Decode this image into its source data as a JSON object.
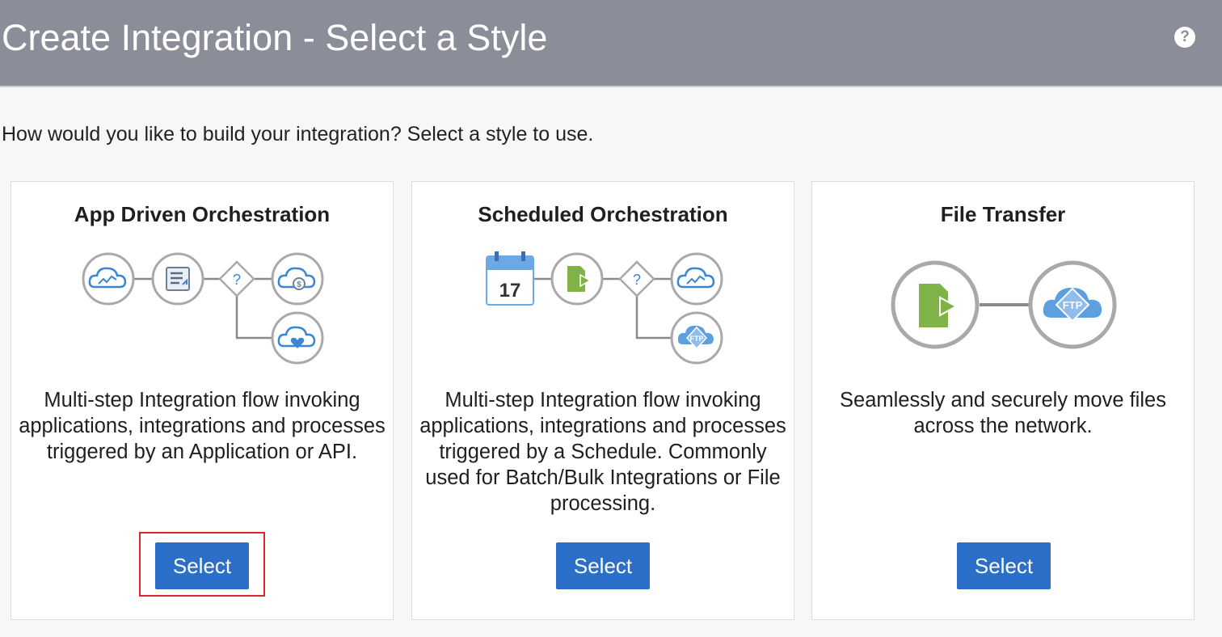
{
  "header": {
    "title": "Create Integration - Select a Style",
    "help_glyph": "?"
  },
  "intro_text": "How would you like to build your integration? Select a style to use.",
  "cards": [
    {
      "title": "App Driven Orchestration",
      "description": "Multi-step Integration flow invoking applications, integrations and processes triggered by an Application or API.",
      "button_label": "Select",
      "highlighted": true
    },
    {
      "title": "Scheduled Orchestration",
      "description": "Multi-step Integration flow invoking applications, integrations and processes triggered by a Schedule. Commonly used for Batch/Bulk Integrations or File processing.",
      "button_label": "Select",
      "calendar_day": "17"
    },
    {
      "title": "File Transfer",
      "description": "Seamlessly and securely move files across the network.",
      "button_label": "Select"
    }
  ],
  "icon_labels": {
    "decision": "?",
    "ftp": "FTP",
    "dollar": "$"
  },
  "colors": {
    "header_bg": "#8b8e99",
    "button_bg": "#2b6fc9",
    "icon_blue": "#3a86d4",
    "file_green": "#7fb347",
    "highlight_red": "#d9262b"
  }
}
